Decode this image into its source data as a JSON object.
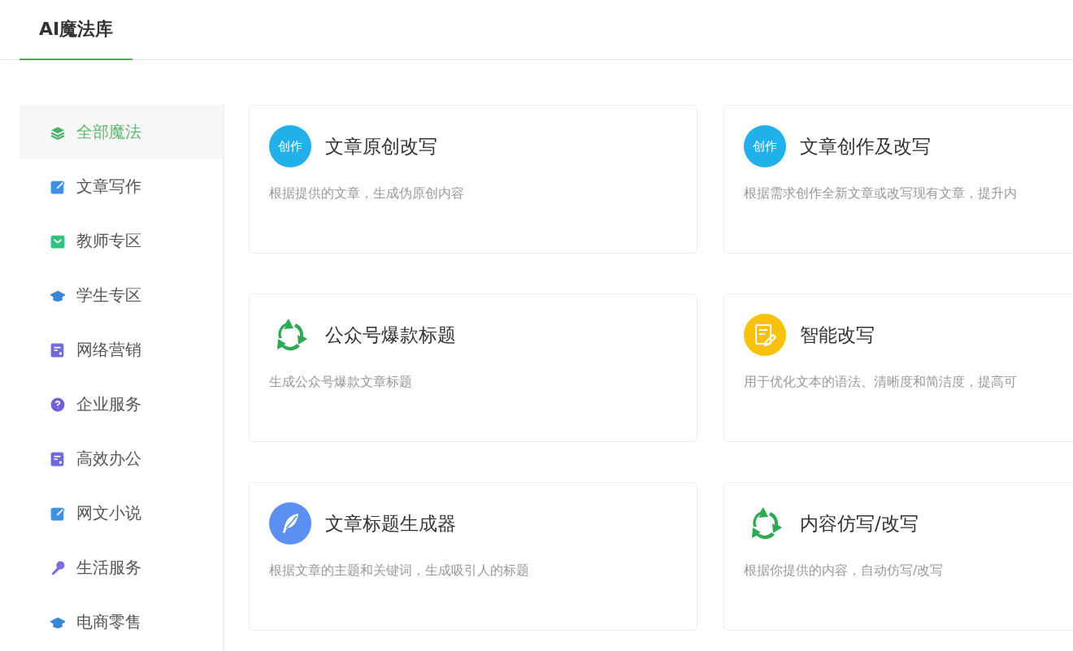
{
  "tabs": [
    {
      "label": "AI魔法库",
      "selected": true
    }
  ],
  "sidebar": {
    "items": [
      {
        "label": "全部魔法",
        "kind": "layers",
        "selected": true
      },
      {
        "label": "文章写作",
        "kind": "edit",
        "selected": false
      },
      {
        "label": "教师专区",
        "kind": "mail",
        "selected": false
      },
      {
        "label": "学生专区",
        "kind": "cap",
        "selected": false
      },
      {
        "label": "网络营销",
        "kind": "form",
        "selected": false
      },
      {
        "label": "企业服务",
        "kind": "help",
        "selected": false
      },
      {
        "label": "高效办公",
        "kind": "form",
        "selected": false
      },
      {
        "label": "网文小说",
        "kind": "edit",
        "selected": false
      },
      {
        "label": "生活服务",
        "kind": "mic",
        "selected": false
      },
      {
        "label": "电商零售",
        "kind": "cap",
        "selected": false
      }
    ]
  },
  "cards": [
    {
      "title": "文章原创改写",
      "description": "根据提供的文章，生成伪原创内容",
      "kind": "badge",
      "badge": "创作"
    },
    {
      "title": "文章创作及改写",
      "description": "根据需求创作全新文章或改写现有文章，提升内",
      "kind": "badge",
      "badge": "创作"
    },
    {
      "title": "公众号爆款标题",
      "description": "生成公众号爆款文章标题",
      "kind": "cycle"
    },
    {
      "title": "智能改写",
      "description": "用于优化文本的语法、清晰度和简洁度，提高可",
      "kind": "note"
    },
    {
      "title": "文章标题生成器",
      "description": "根据文章的主题和关键词，生成吸引人的标题",
      "kind": "feather"
    },
    {
      "title": "内容仿写/改写",
      "description": "根据你提供的内容，自动仿写/改写",
      "kind": "cycle"
    }
  ]
}
